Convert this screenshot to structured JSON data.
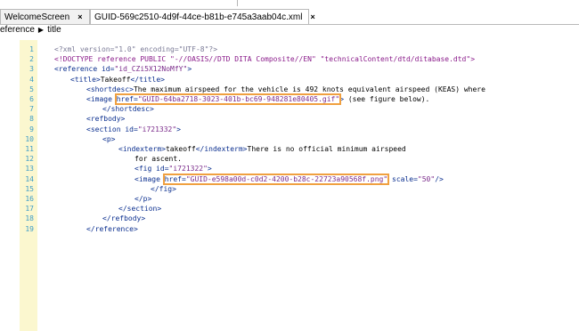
{
  "tabs": [
    {
      "label": "WelcomeScreen",
      "close": "×"
    },
    {
      "label": "GUID-569c2510-4d9f-44ce-b81b-e745a3aab04c.xml",
      "close": "×"
    }
  ],
  "breadcrumb": {
    "parent": "eference",
    "child": "title"
  },
  "lines": [
    {
      "n": "1",
      "parts": [
        [
          "pi",
          "<?xml version=\"1.0\" encoding=\"UTF-8\"?>"
        ]
      ]
    },
    {
      "n": "2",
      "parts": [
        [
          "dt",
          "<!DOCTYPE reference PUBLIC \"-//OASIS//DTD DITA Composite//EN\" \"technicalContent/dtd/ditabase.dtd\">"
        ]
      ]
    },
    {
      "n": "3",
      "parts": [
        [
          "tag",
          "<reference "
        ],
        [
          "attr",
          "id="
        ],
        [
          "str",
          "\"id_CZi5X12NoMfY\""
        ],
        [
          "tag",
          ">"
        ]
      ]
    },
    {
      "n": "4",
      "parts": [
        [
          "tag",
          "<title>"
        ],
        [
          "txt",
          "Takeoff"
        ],
        [
          "tag",
          "</title>"
        ]
      ]
    },
    {
      "n": "5",
      "parts": [
        [
          "tag",
          "<shortdesc>"
        ],
        [
          "txt",
          "The maximum airspeed for the vehicle is 492 knots equivalent airspeed (KEAS) where"
        ]
      ]
    },
    {
      "n": "6",
      "parts": [
        [
          "tag",
          "<image "
        ],
        [
          "hlattr",
          "href="
        ],
        [
          "hlstr",
          "\"GUID-64ba2718-3023-401b-bc69-948281e80405.gif\""
        ],
        [
          "tag",
          "> "
        ],
        [
          "txt",
          "(see figure below)."
        ]
      ]
    },
    {
      "n": "7",
      "parts": [
        [
          "tag",
          "</shortdesc>"
        ]
      ]
    },
    {
      "n": "8",
      "parts": [
        [
          "tag",
          "<refbody>"
        ]
      ]
    },
    {
      "n": "9",
      "parts": [
        [
          "tag",
          "<section "
        ],
        [
          "attr",
          "id="
        ],
        [
          "str",
          "\"i721332\""
        ],
        [
          "tag",
          ">"
        ]
      ]
    },
    {
      "n": "10",
      "parts": [
        [
          "tag",
          "<p>"
        ]
      ]
    },
    {
      "n": "11",
      "parts": [
        [
          "tag",
          "<indexterm>"
        ],
        [
          "txt",
          "takeoff"
        ],
        [
          "tag",
          "</indexterm>"
        ],
        [
          "txt",
          "There is no official minimum airspeed"
        ]
      ]
    },
    {
      "n": "12",
      "parts": [
        [
          "txt",
          "for ascent."
        ]
      ]
    },
    {
      "n": "13",
      "parts": [
        [
          "tag",
          "<fig "
        ],
        [
          "attr",
          "id="
        ],
        [
          "str",
          "\"i721322\""
        ],
        [
          "tag",
          ">"
        ]
      ]
    },
    {
      "n": "14",
      "parts": [
        [
          "tag",
          "<image "
        ],
        [
          "hlattr",
          "href="
        ],
        [
          "hlstr",
          "\"GUID-e598a00d-c0d2-4200-b28c-22723a90568f.png\""
        ],
        [
          "tag",
          " "
        ],
        [
          "attr",
          "scale="
        ],
        [
          "str",
          "\"50\""
        ],
        [
          "tag",
          "/>"
        ]
      ]
    },
    {
      "n": "15",
      "parts": [
        [
          "tag",
          "</fig>"
        ]
      ]
    },
    {
      "n": "16",
      "parts": [
        [
          "tag",
          "</p>"
        ]
      ]
    },
    {
      "n": "17",
      "parts": [
        [
          "tag",
          "</section>"
        ]
      ]
    },
    {
      "n": "18",
      "parts": [
        [
          "tag",
          "</refbody>"
        ]
      ]
    },
    {
      "n": "19",
      "parts": [
        [
          "tag",
          "</reference>"
        ]
      ]
    }
  ],
  "colors": {
    "highlight_box": "#f0a040",
    "gutter": "#fbf7cf",
    "line_numbers": "#3c9cc8"
  }
}
